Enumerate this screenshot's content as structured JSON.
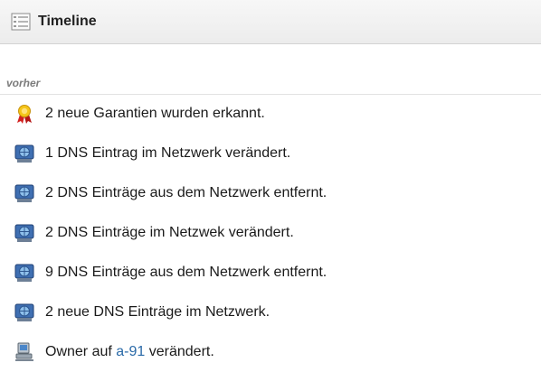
{
  "header": {
    "title": "Timeline",
    "icon": "timeline-list-icon"
  },
  "section": {
    "label": "vorher"
  },
  "items": [
    {
      "icon": "award-ribbon-icon",
      "text": "2 neue Garantien wurden erkannt."
    },
    {
      "icon": "network-globe-icon",
      "text": "1 DNS Eintrag im Netzwerk verändert."
    },
    {
      "icon": "network-globe-icon",
      "text": "2 DNS Einträge aus dem Netzwerk entfernt."
    },
    {
      "icon": "network-globe-icon",
      "text": "2 DNS Einträge im Netzwek verändert."
    },
    {
      "icon": "network-globe-icon",
      "text": "9 DNS Einträge aus dem Netzwerk entfernt."
    },
    {
      "icon": "network-globe-icon",
      "text": "2 neue DNS Einträge im Netzwerk."
    },
    {
      "icon": "computer-icon",
      "text_before": "Owner auf",
      "link": "a-91",
      "text_after": "verändert."
    }
  ],
  "colors": {
    "link": "#2a6aa8",
    "section_label": "#7c7c7c"
  }
}
